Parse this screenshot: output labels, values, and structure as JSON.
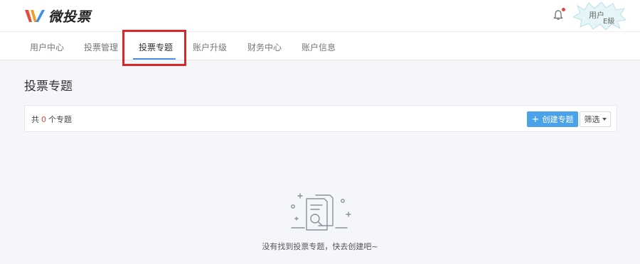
{
  "header": {
    "logo_text": "微投票",
    "user_name": "用户",
    "user_level": "E級"
  },
  "nav": {
    "items": [
      {
        "label": "用户中心"
      },
      {
        "label": "投票管理"
      },
      {
        "label": "投票专题",
        "active": true
      },
      {
        "label": "账户升级"
      },
      {
        "label": "财务中心"
      },
      {
        "label": "账户信息"
      }
    ]
  },
  "page": {
    "title": "投票专题",
    "count_prefix": "共",
    "count_value": "0",
    "count_suffix": "个专题",
    "create_label": "创建专题",
    "filter_label": "筛选"
  },
  "empty": {
    "message": "没有找到投票专题，快去创建吧~"
  },
  "colors": {
    "accent": "#4aa3e8",
    "highlight": "#d8282a",
    "count": "#e0483e"
  },
  "icons": [
    "bell-icon",
    "plus-icon",
    "caret-down-icon",
    "empty-document-search-icon"
  ]
}
